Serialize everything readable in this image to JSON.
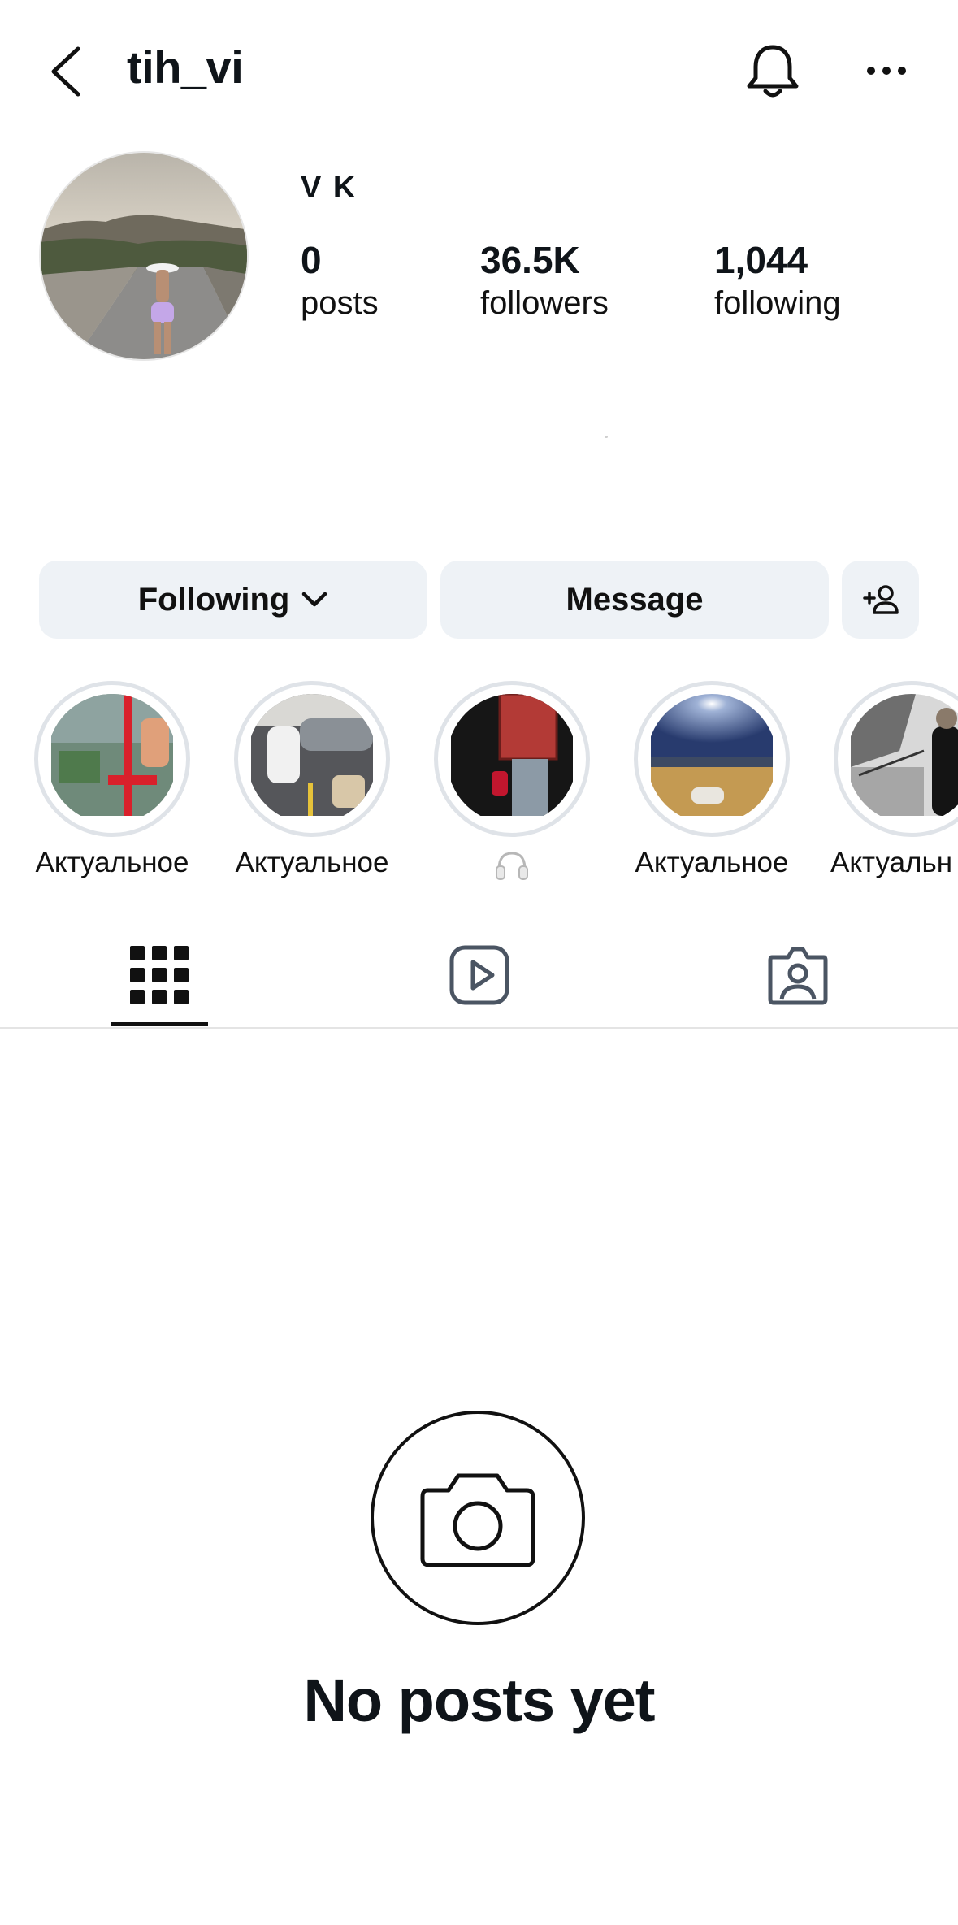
{
  "header": {
    "username": "tih_vi",
    "back_icon": "chevron-left-icon",
    "bell_icon": "bell-icon",
    "more_icon": "more-horizontal-icon"
  },
  "profile": {
    "display_name": "V K",
    "stats": {
      "posts": {
        "value": "0",
        "label": "posts"
      },
      "followers": {
        "value": "36.5K",
        "label": "followers"
      },
      "following": {
        "value": "1,044",
        "label": "following"
      }
    }
  },
  "actions": {
    "following_label": "Following",
    "message_label": "Message",
    "add_user_icon": "add-person-icon"
  },
  "highlights": [
    {
      "label": "Актуальное"
    },
    {
      "label": "Актуальное"
    },
    {
      "label": "",
      "icon": "headphones-icon"
    },
    {
      "label": "Актуальное"
    },
    {
      "label": "Актуальн"
    }
  ],
  "tabs": [
    {
      "name": "grid",
      "icon": "grid-icon",
      "active": true
    },
    {
      "name": "reels",
      "icon": "reels-icon",
      "active": false
    },
    {
      "name": "tagged",
      "icon": "tagged-icon",
      "active": false
    }
  ],
  "empty_state": {
    "icon": "camera-icon",
    "text": "No posts yet"
  },
  "colors": {
    "button_bg": "#eef2f6",
    "text": "#0f1419",
    "ring": "#dfe3e8"
  }
}
